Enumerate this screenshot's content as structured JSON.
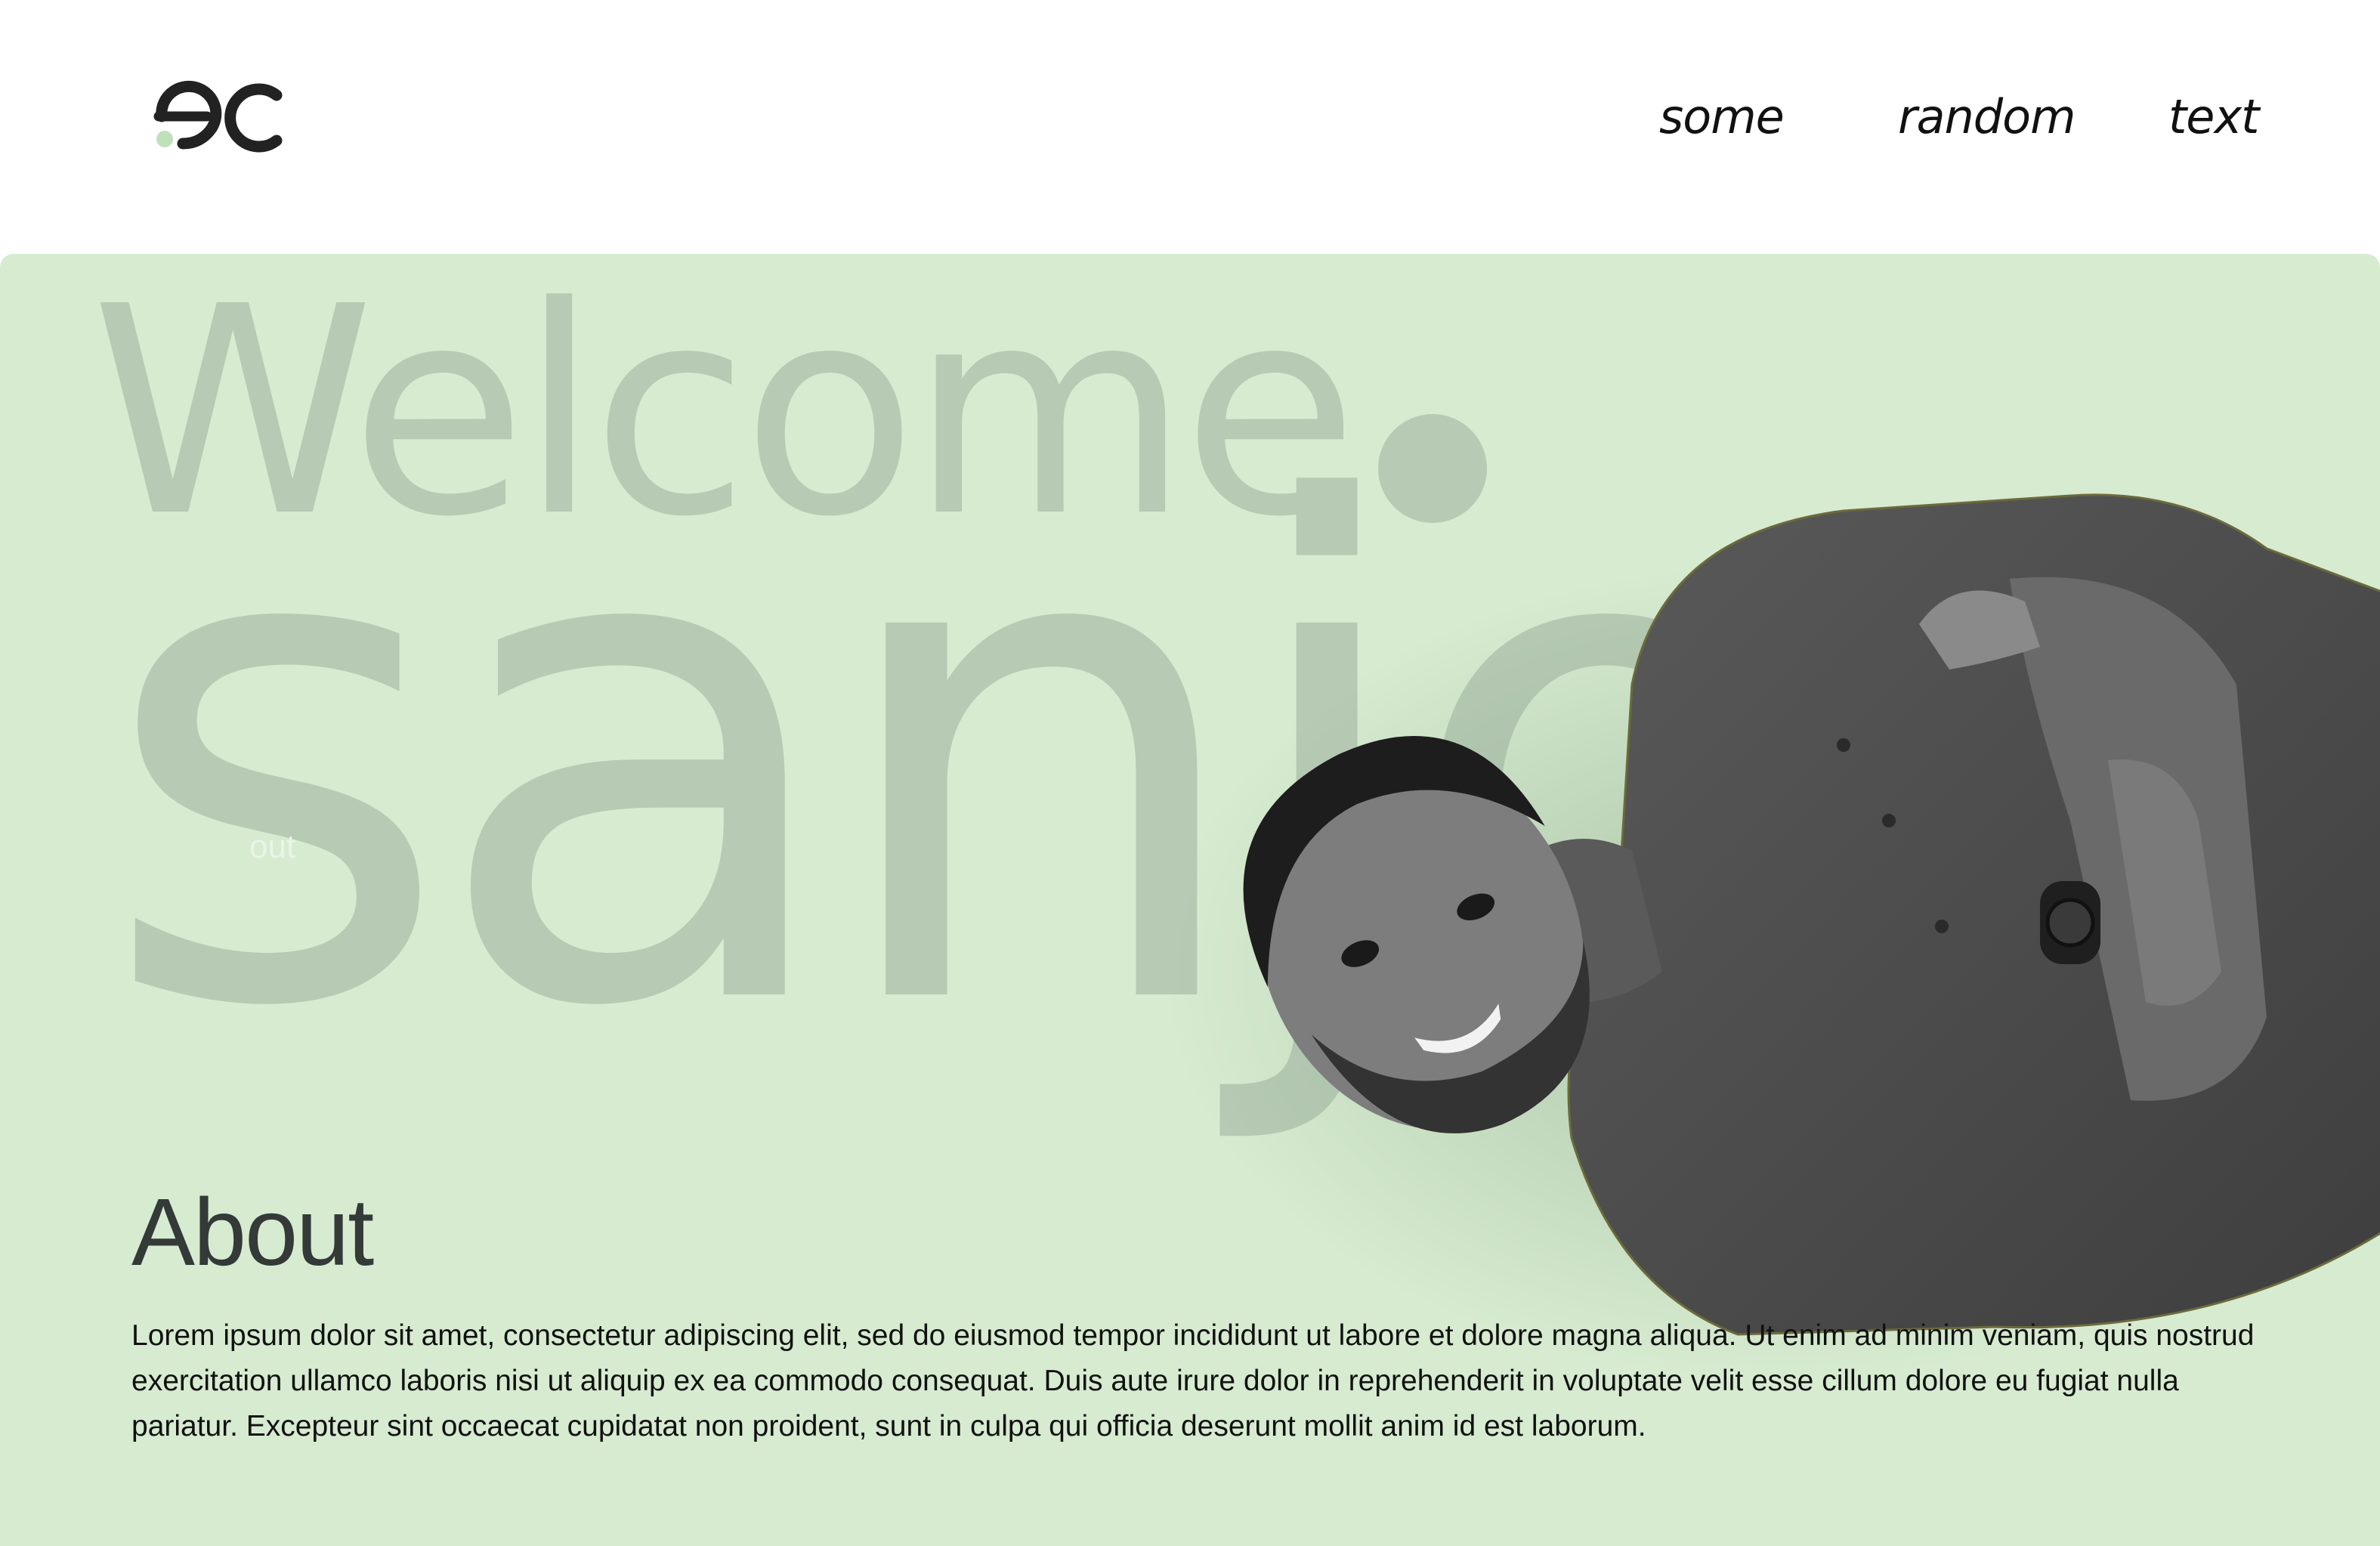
{
  "header": {
    "logo_icon": "ec-monogram-logo",
    "nav": [
      "some",
      "random",
      "text"
    ]
  },
  "hero": {
    "bg_welcome": "Welcome",
    "bg_name": "sanjo",
    "ghost_label": "out",
    "photo_icon": "portrait-photo",
    "colors": {
      "background": "#d6ebd0",
      "watermark": "#b6cab4",
      "heading": "#333a38"
    }
  },
  "about": {
    "title": "About",
    "text": "Lorem ipsum dolor sit amet, consectetur adipiscing elit, sed do eiusmod tempor incididunt ut labore et dolore magna aliqua. Ut enim ad minim veniam, quis nostrud exercitation ullamco laboris nisi ut aliquip ex ea commodo consequat. Duis aute irure dolor in reprehenderit in voluptate velit esse cillum dolore eu fugiat nulla pariatur. Excepteur sint occaecat cupidatat non proident, sunt in culpa qui officia deserunt mollit anim id est laborum."
  }
}
